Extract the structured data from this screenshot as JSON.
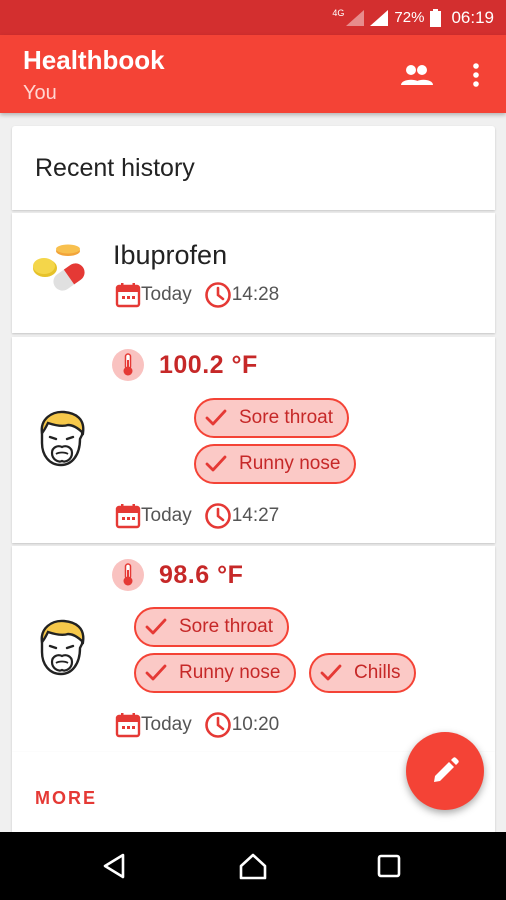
{
  "status_bar": {
    "network": "4G",
    "battery": "72%",
    "time": "06:19"
  },
  "app_bar": {
    "title": "Healthbook",
    "subtitle": "You",
    "people_icon": "people-icon",
    "overflow_icon": "more-vert-icon"
  },
  "section": {
    "title": "Recent history"
  },
  "entries": [
    {
      "type": "medication",
      "name": "Ibuprofen",
      "date": "Today",
      "time": "14:28",
      "icon": "pills-icon"
    },
    {
      "type": "symptoms",
      "temperature": "100.2 °F",
      "symptoms": [
        "Sore throat",
        "Runny nose"
      ],
      "date": "Today",
      "time": "14:27",
      "icon": "sick-face-icon"
    },
    {
      "type": "symptoms",
      "temperature": "98.6 °F",
      "symptoms": [
        "Sore throat",
        "Runny nose",
        "Chills"
      ],
      "date": "Today",
      "time": "10:20",
      "icon": "sick-face-icon"
    }
  ],
  "more_label": "MORE",
  "fab": {
    "icon": "pencil-icon"
  },
  "nav": {
    "back": "back-icon",
    "home": "home-icon",
    "recents": "recents-icon"
  },
  "colors": {
    "primary": "#f44336",
    "primary_dark": "#d32f2f",
    "chip_bg": "#fbc9c6",
    "accent_text": "#c62828"
  }
}
